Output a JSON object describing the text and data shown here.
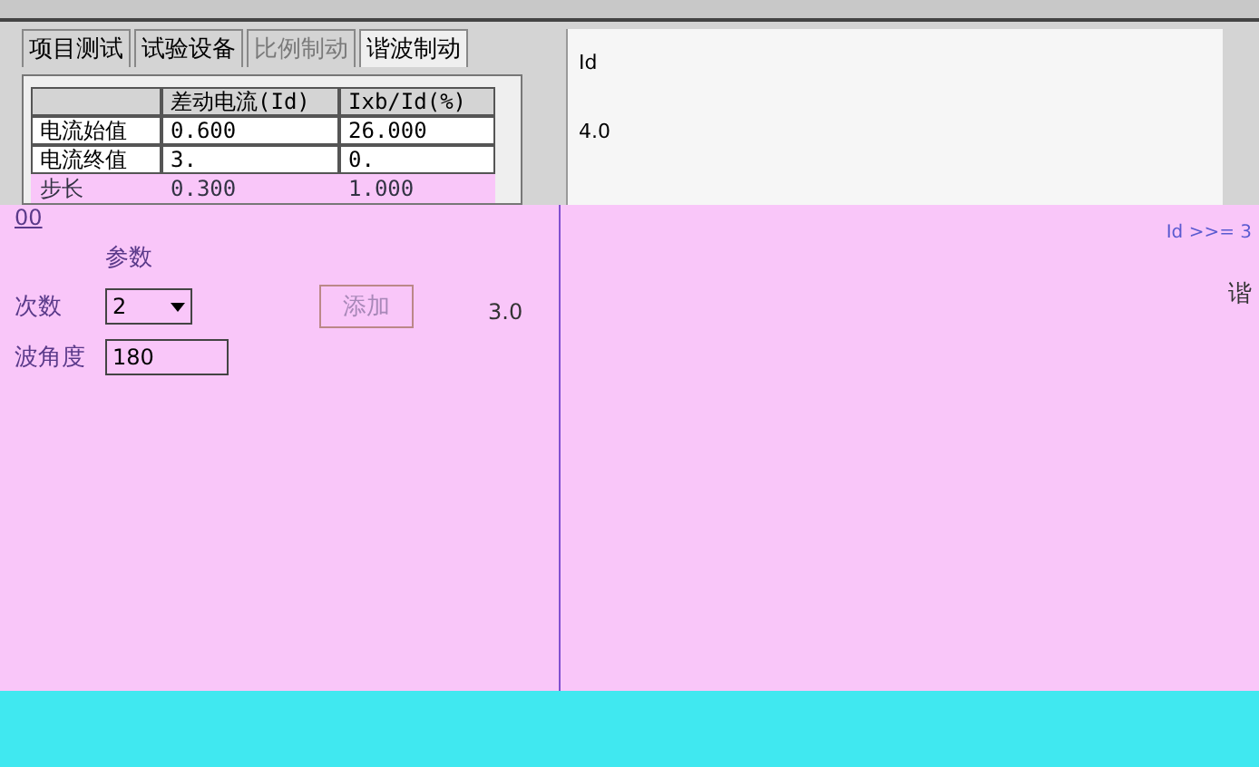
{
  "tabs": [
    {
      "label": "项目测试",
      "selected": false,
      "disabled": false
    },
    {
      "label": "试验设备",
      "selected": false,
      "disabled": false
    },
    {
      "label": "比例制动",
      "selected": false,
      "disabled": true
    },
    {
      "label": "谐波制动",
      "selected": true,
      "disabled": false
    }
  ],
  "table": {
    "columns": [
      "差动电流(Id)",
      "Ixb/Id(%)"
    ],
    "rows": [
      {
        "label": "电流始值",
        "cells": [
          "0.600",
          "26.000"
        ]
      },
      {
        "label": "电流终值",
        "cells": [
          "3.",
          "0."
        ]
      },
      {
        "label": "步长",
        "cells": [
          "0.300",
          "1.000"
        ]
      }
    ]
  },
  "chart": {
    "ylabel": "Id",
    "ticks": [
      "4.0",
      "3.0"
    ],
    "legend": "Id >>= 3"
  },
  "form": {
    "fragment": "00",
    "params_label": "参数",
    "order_label": "次数",
    "order_value": "2",
    "angle_label": "波角度",
    "angle_value": "180",
    "add_button": "添加",
    "side_label": "谐"
  }
}
